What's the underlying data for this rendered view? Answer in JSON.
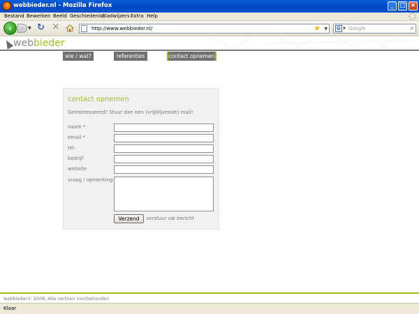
{
  "window": {
    "title": "webbieder.nl - Mozilla Firefox"
  },
  "menu": [
    "Bestand",
    "Bewerken",
    "Beeld",
    "Geschiedenis",
    "Bladwijzers",
    "Extra",
    "Help"
  ],
  "nav": {
    "url": "http://www.webbieder.nl/",
    "search_placeholder": "Google",
    "search_engine_icon": "G"
  },
  "site": {
    "logo_web": "web",
    "logo_bieder": "bieder",
    "tabs": [
      "wie / wat?",
      "referenties",
      "contact opnemen"
    ],
    "active_tab": "contact opnemen"
  },
  "form": {
    "heading": "contact opnemen",
    "intro": "Geinteresseerd? Stuur dan een (vrijblijvende) mail!",
    "labels": [
      "naam *",
      "email *",
      "tel.",
      "bedrijf",
      "website",
      "vraag / opmerking *"
    ],
    "submit": "Verzend",
    "submit_hint": "verstuur uw bericht"
  },
  "footer": "webbieder© 2008. Alle rechten voorbehouden",
  "status": "Klaar",
  "colors": {
    "accent": "#95c11f",
    "tab_bg": "#6e7170",
    "titlebar": "#0a5fd8"
  }
}
